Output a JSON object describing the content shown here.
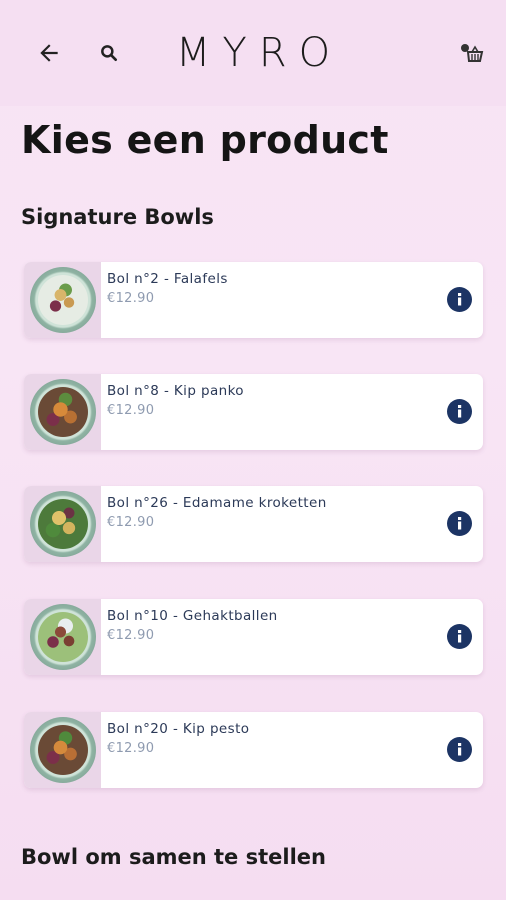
{
  "header": {
    "logo": "MYRO",
    "back_icon": "arrow-left-icon",
    "search_icon": "search-icon",
    "cart_icon": "shopping-basket-icon"
  },
  "page": {
    "title": "Kies een product"
  },
  "sections": [
    {
      "title": "Signature Bowls"
    },
    {
      "title": "Bowl om samen te stellen"
    }
  ],
  "products": [
    {
      "name": "Bol n°2 - Falafels",
      "price": "€12.90"
    },
    {
      "name": "Bol n°8 - Kip panko",
      "price": "€12.90"
    },
    {
      "name": "Bol n°26 - Edamame kroketten",
      "price": "€12.90"
    },
    {
      "name": "Bol n°10 - Gehaktballen",
      "price": "€12.90"
    },
    {
      "name": "Bol n°20 - Kip pesto",
      "price": "€12.90"
    }
  ],
  "colors": {
    "background": "#f7e3f4",
    "info_button": "#1c3464",
    "product_name": "#2c3a58",
    "price": "#8f9bb0"
  }
}
